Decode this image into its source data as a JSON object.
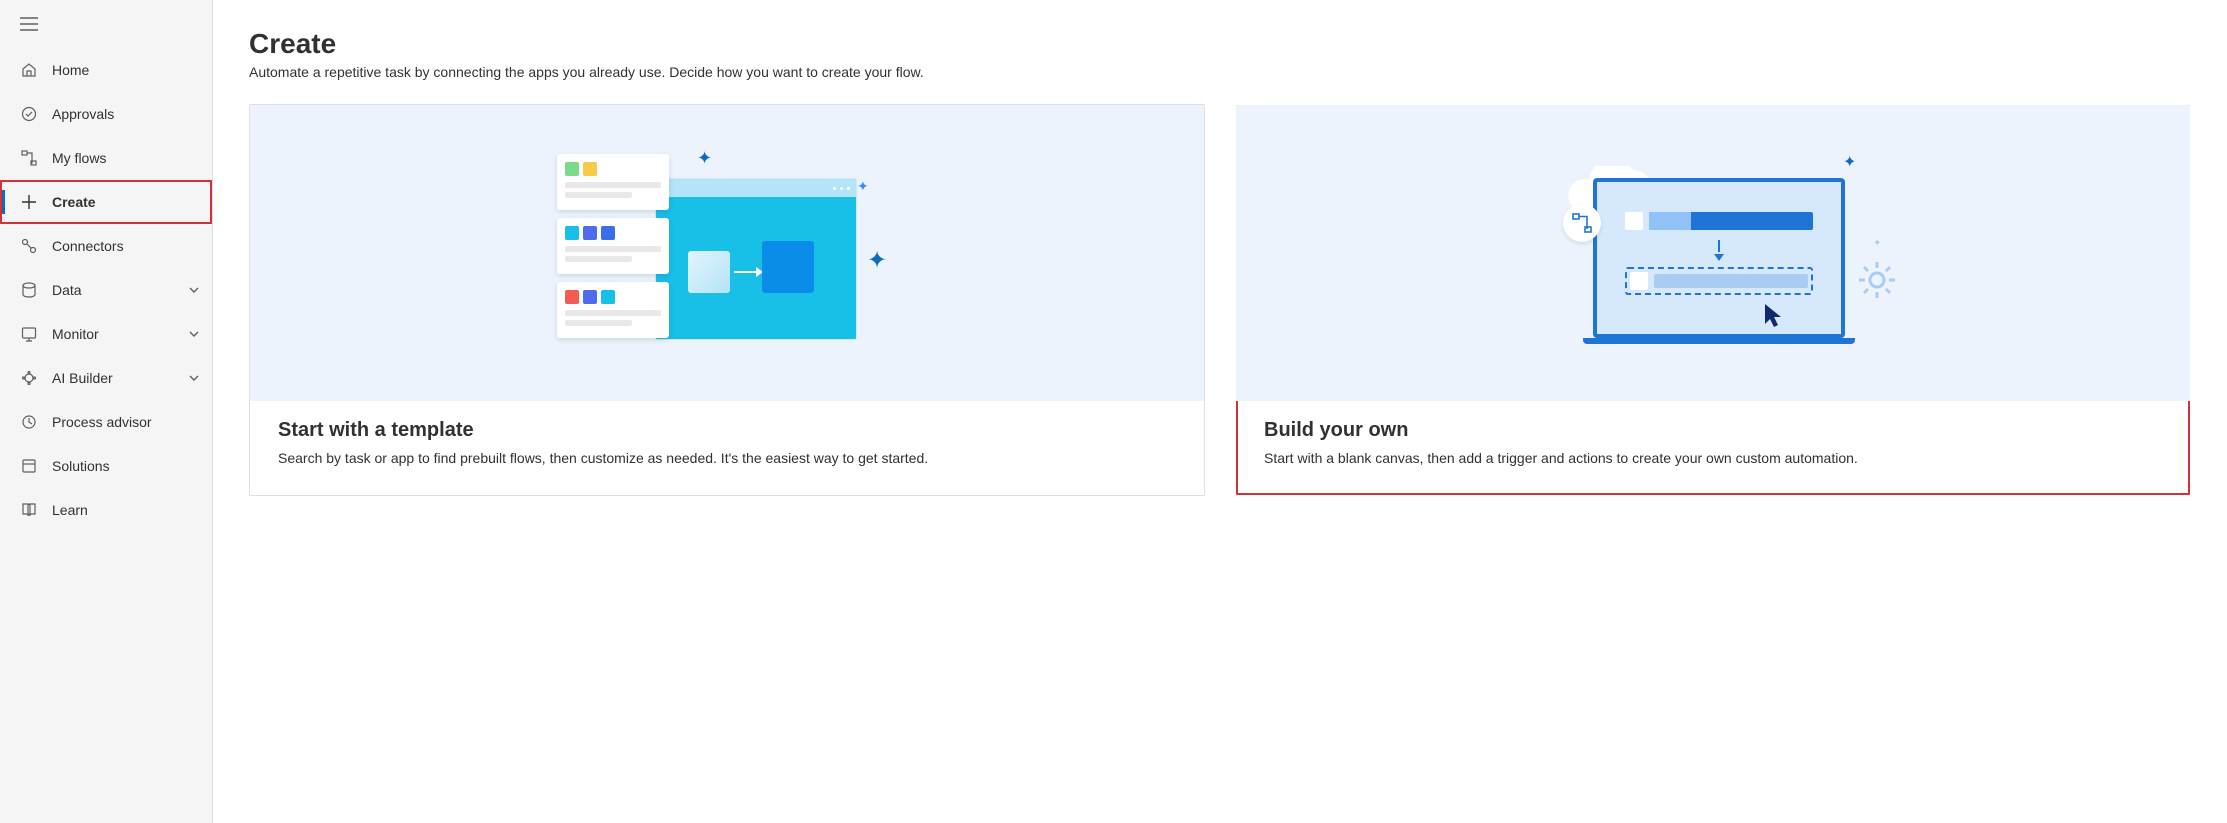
{
  "sidebar": {
    "items": [
      {
        "label": "Home",
        "icon": "home-icon",
        "chevron": false
      },
      {
        "label": "Approvals",
        "icon": "approvals-icon",
        "chevron": false
      },
      {
        "label": "My flows",
        "icon": "flows-icon",
        "chevron": false
      },
      {
        "label": "Create",
        "icon": "plus-icon",
        "chevron": false,
        "selected": true
      },
      {
        "label": "Connectors",
        "icon": "connectors-icon",
        "chevron": false
      },
      {
        "label": "Data",
        "icon": "data-icon",
        "chevron": true
      },
      {
        "label": "Monitor",
        "icon": "monitor-icon",
        "chevron": true
      },
      {
        "label": "AI Builder",
        "icon": "ai-builder-icon",
        "chevron": true
      },
      {
        "label": "Process advisor",
        "icon": "process-advisor-icon",
        "chevron": false
      },
      {
        "label": "Solutions",
        "icon": "solutions-icon",
        "chevron": false
      },
      {
        "label": "Learn",
        "icon": "learn-icon",
        "chevron": false
      }
    ]
  },
  "page": {
    "title": "Create",
    "subtitle": "Automate a repetitive task by connecting the apps you already use. Decide how you want to create your flow."
  },
  "cards": {
    "template": {
      "title": "Start with a template",
      "desc": "Search by task or app to find prebuilt flows, then customize as needed. It's the easiest way to get started."
    },
    "build": {
      "title": "Build your own",
      "desc": "Start with a blank canvas, then add a trigger and actions to create your own custom automation."
    }
  }
}
